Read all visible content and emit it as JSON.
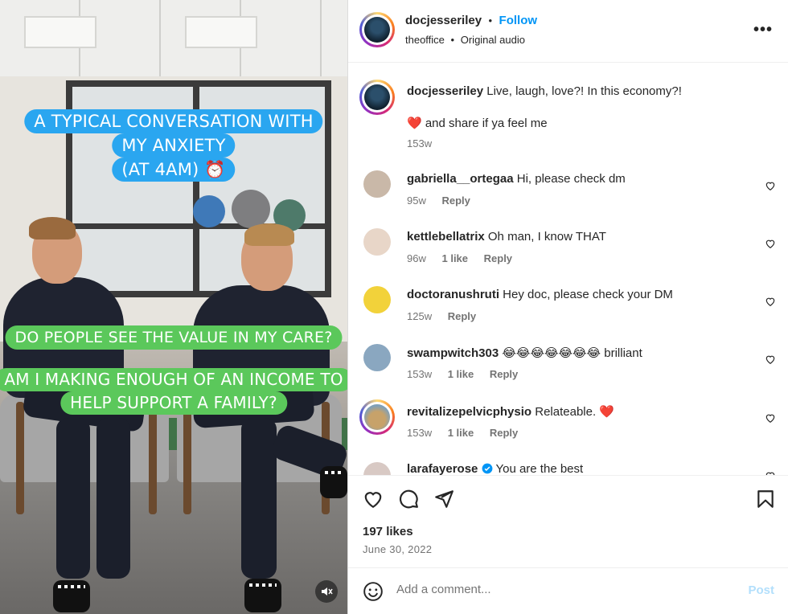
{
  "video": {
    "caption_top": [
      "A TYPICAL CONVERSATION WITH",
      "MY ANXIETY",
      "(AT 4AM) ⏰"
    ],
    "caption_mid": [
      "DO PEOPLE SEE THE VALUE IN MY CARE?"
    ],
    "caption_low": [
      "AM I MAKING ENOUGH OF AN INCOME TO",
      "HELP SUPPORT A FAMILY?"
    ],
    "mute_icon": "speaker-muted-icon"
  },
  "header": {
    "username": "docjesseriley",
    "separator": "•",
    "follow": "Follow",
    "location": "theoffice",
    "audio": "Original audio",
    "more": "•••"
  },
  "caption": {
    "username": "docjesseriley",
    "line1": "Live, laugh, love?! In this economy?!",
    "line2": "❤️ and share if ya feel me",
    "time": "153w"
  },
  "comments": [
    {
      "username": "gabriella__ortegaa",
      "text": "Hi, please check dm",
      "time": "95w",
      "likes": "",
      "reply": "Reply",
      "avatar_color": "#c9b8a8"
    },
    {
      "username": "kettlebellatrix",
      "text": "Oh man, I know THAT",
      "time": "96w",
      "likes": "1 like",
      "reply": "Reply",
      "avatar_color": "#e8d6c8"
    },
    {
      "username": "doctoranushruti",
      "text": "Hey doc, please check your DM",
      "time": "125w",
      "likes": "",
      "reply": "Reply",
      "avatar_color": "#f2d23a"
    },
    {
      "username": "swampwitch303",
      "text": "😂😂😂😂😂😂😂 brilliant",
      "time": "153w",
      "likes": "1 like",
      "reply": "Reply",
      "avatar_color": "#8aa7c0"
    },
    {
      "username": "revitalizepelvicphysio",
      "text": "Relateable. ❤️",
      "time": "153w",
      "likes": "1 like",
      "reply": "Reply",
      "avatar_color": "#c7a26a"
    },
    {
      "username": "larafayerose",
      "text": "You are the best",
      "time": "",
      "likes": "",
      "reply": "",
      "avatar_color": "#d8c9c4"
    }
  ],
  "post": {
    "likes": "197 likes",
    "date": "June 30, 2022"
  },
  "add_comment": {
    "placeholder": "Add a comment...",
    "post": "Post"
  },
  "colors": {
    "accent": "#0095f6",
    "caption_blue": "#2aa6f0",
    "caption_green": "#5bc85b",
    "verified": "#0095f6",
    "post_disabled": "#b2dffc"
  }
}
